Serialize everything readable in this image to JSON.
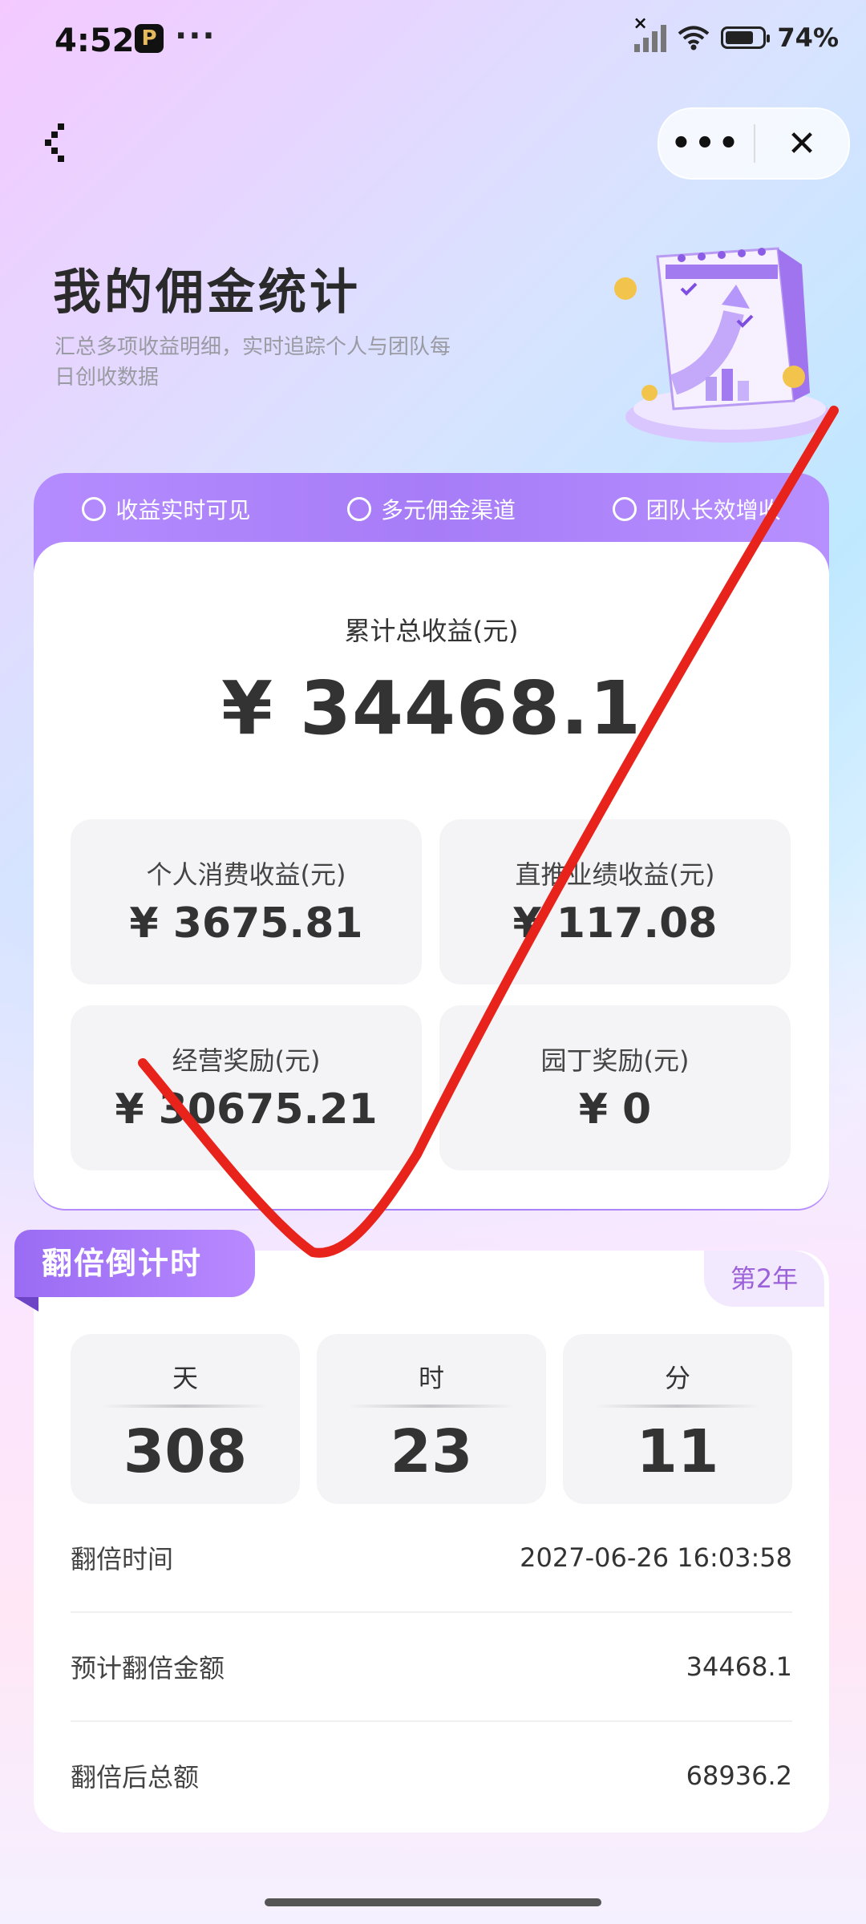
{
  "status_bar": {
    "time": "4:52",
    "app_icon_letter": "P",
    "more": "···",
    "battery": "74%"
  },
  "nav": {
    "more": "•••",
    "close": "✕"
  },
  "header": {
    "title": "我的佣金统计",
    "subtitle": "汇总多项收益明细，实时追踪个人与团队每日创收数据"
  },
  "features": [
    {
      "label": "收益实时可见",
      "icon": "clock-icon"
    },
    {
      "label": "多元佣金渠道",
      "icon": "network-icon"
    },
    {
      "label": "团队长效增收",
      "icon": "refresh-clock-icon"
    }
  ],
  "summary": {
    "total_label": "累计总收益(元)",
    "total_value": "¥ 34468.1",
    "stats": [
      {
        "label": "个人消费收益(元)",
        "value": "¥ 3675.81"
      },
      {
        "label": "直推业绩收益(元)",
        "value": "¥ 117.08"
      },
      {
        "label": "经营奖励(元)",
        "value": "¥ 30675.21"
      },
      {
        "label": "园丁奖励(元)",
        "value": "¥ 0"
      }
    ]
  },
  "countdown": {
    "badge": "翻倍倒计时",
    "year": "第2年",
    "units": [
      {
        "label": "天",
        "value": "308"
      },
      {
        "label": "时",
        "value": "23"
      },
      {
        "label": "分",
        "value": "11"
      }
    ],
    "rows": [
      {
        "label": "翻倍时间",
        "value": "2027-06-26 16:03:58"
      },
      {
        "label": "预计翻倍金额",
        "value": "34468.1"
      },
      {
        "label": "翻倍后总额",
        "value": "68936.2"
      }
    ]
  },
  "colors": {
    "accent": "#a77cf7",
    "check_mark": "#e8231b"
  }
}
